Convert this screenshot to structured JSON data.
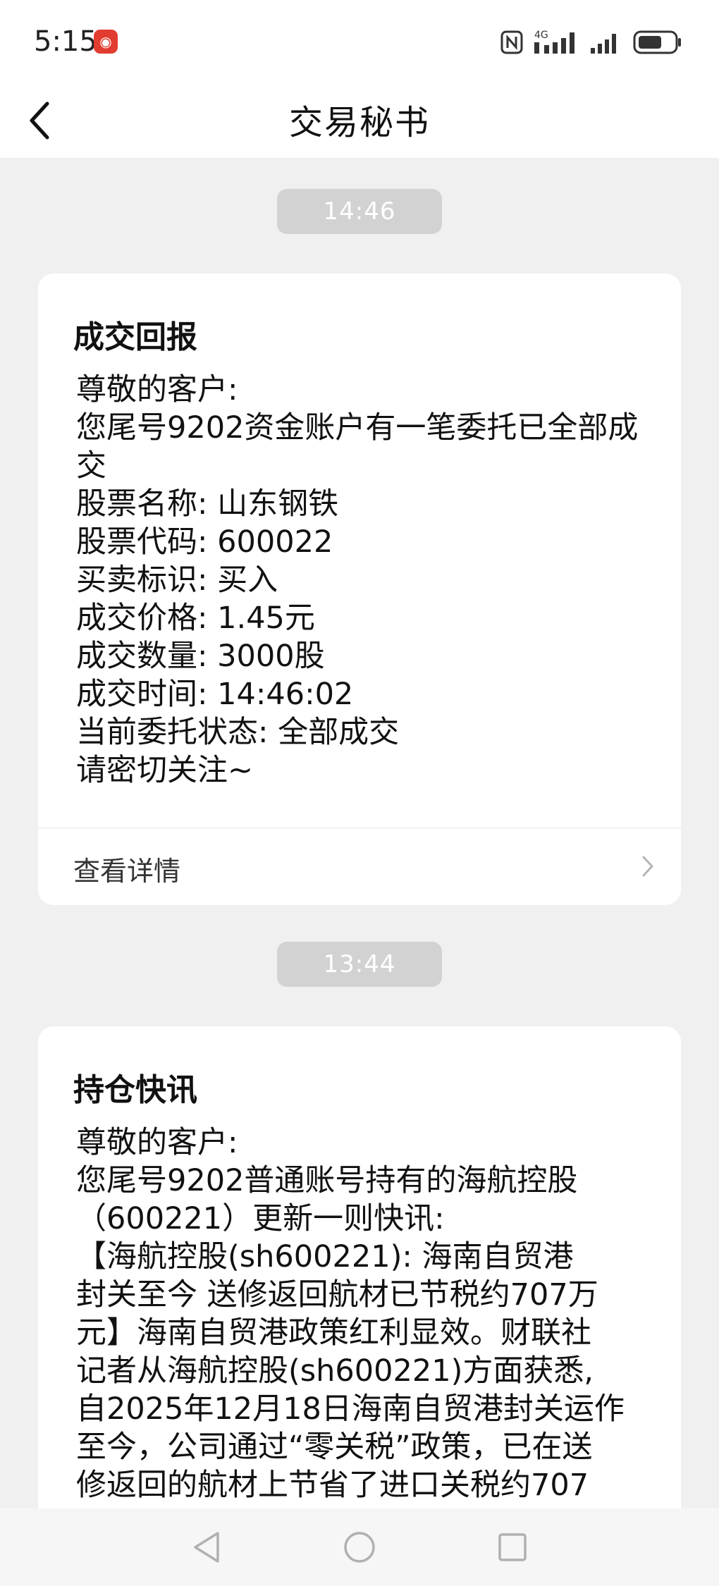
{
  "status_bar": {
    "time": "5:15",
    "badge_glyph": "◉",
    "network_label": "4G",
    "icons": [
      "nfc-icon",
      "signal-4g-icon",
      "signal-icon",
      "battery-icon"
    ]
  },
  "header": {
    "title": "交易秘书",
    "back_icon": "chevron-left-icon"
  },
  "messages": [
    {
      "time": "14:46",
      "title": "成交回报",
      "greeting": "尊敬的客户:",
      "intro": "您尾号9202资金账户有一笔委托已全部成交",
      "fields": [
        {
          "label": "股票名称:",
          "value": "山东钢铁"
        },
        {
          "label": "股票代码:",
          "value": "600022"
        },
        {
          "label": "买卖标识:",
          "value": "买入"
        },
        {
          "label": "成交价格:",
          "value": "1.45元"
        },
        {
          "label": "成交数量:",
          "value": "3000股"
        },
        {
          "label": "成交时间:",
          "value": "14:46:02"
        },
        {
          "label": "当前委托状态:",
          "value": "全部成交"
        }
      ],
      "closing": "请密切关注~",
      "footer_label": "查看详情"
    },
    {
      "time": "13:44",
      "title": "持仓快讯",
      "greeting": "尊敬的客户:",
      "lines": [
        "您尾号9202普通账号持有的海航控股",
        "（600221）更新一则快讯:",
        "【海航控股(sh600221): 海南自贸港",
        "封关至今 送修返回航材已节税约707万",
        "元】海南自贸港政策红利显效。财联社",
        "记者从海航控股(sh600221)方面获悉,",
        "自2025年12月18日海南自贸港封关运作",
        "至今，公司通过“零关税”政策，已在送",
        "修返回的航材上节省了进口关税约707"
      ]
    }
  ],
  "nav_bar": {
    "buttons": [
      "back-triangle-icon",
      "home-circle-icon",
      "recents-square-icon"
    ]
  },
  "colors": {
    "background": "#f0f0f0",
    "card": "#ffffff",
    "time_pill": "#d2d2d2",
    "badge": "#e23b30"
  }
}
